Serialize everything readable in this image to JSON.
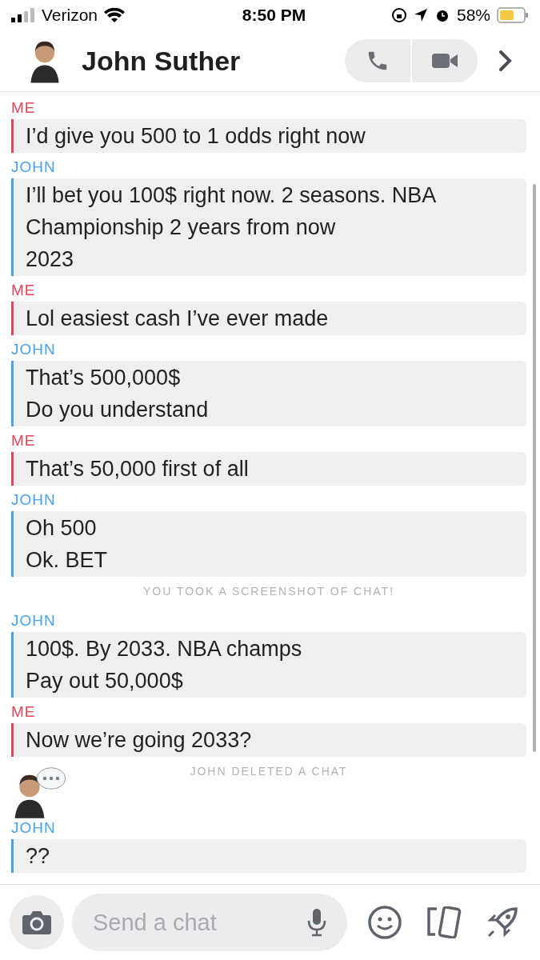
{
  "status_bar": {
    "carrier": "Verizon",
    "time": "8:50 PM",
    "battery": "58%"
  },
  "header": {
    "name": "John Suther"
  },
  "messages": [
    {
      "kind": "message",
      "sender": "ME",
      "color": "#e0475a",
      "lines": [
        "I’d give you 500 to 1 odds right now"
      ]
    },
    {
      "kind": "message",
      "sender": "JOHN",
      "color": "#4aa3e8",
      "lines": [
        "I’ll bet you 100$ right now. 2 seasons. NBA",
        "Championship 2 years from now",
        "2023"
      ]
    },
    {
      "kind": "message",
      "sender": "ME",
      "color": "#e0475a",
      "lines": [
        "Lol easiest cash I’ve ever made"
      ]
    },
    {
      "kind": "message",
      "sender": "JOHN",
      "color": "#4aa3e8",
      "lines": [
        "That’s 500,000$",
        "Do you understand"
      ]
    },
    {
      "kind": "message",
      "sender": "ME",
      "color": "#e0475a",
      "lines": [
        "That’s 50,000 first of all"
      ]
    },
    {
      "kind": "message",
      "sender": "JOHN",
      "color": "#4aa3e8",
      "lines": [
        "Oh 500",
        "Ok. BET"
      ]
    },
    {
      "kind": "notice",
      "text": "YOU TOOK A SCREENSHOT OF CHAT!"
    },
    {
      "kind": "message",
      "sender": "JOHN",
      "color": "#4aa3e8",
      "lines": [
        "100$. By 2033. NBA champs",
        "Pay out 50,000$"
      ]
    },
    {
      "kind": "message",
      "sender": "ME",
      "color": "#e0475a",
      "lines": [
        "Now we’re going 2033?"
      ]
    },
    {
      "kind": "notice",
      "text": "JOHN DELETED A CHAT"
    },
    {
      "kind": "message",
      "sender": "JOHN",
      "color": "#4aa3e8",
      "lines": [
        "??"
      ]
    }
  ],
  "composer": {
    "placeholder": "Send a chat"
  }
}
